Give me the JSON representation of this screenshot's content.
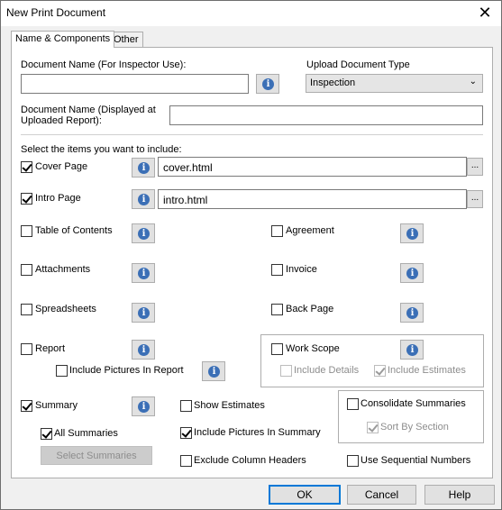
{
  "window": {
    "title": "New Print Document",
    "close_glyph": "✕"
  },
  "tabs": [
    {
      "label": "Name & Components",
      "active": true
    },
    {
      "label": "Other",
      "active": false
    }
  ],
  "form": {
    "doc_name_label": "Document Name (For Inspector Use):",
    "doc_name_value": "",
    "upload_type_label": "Upload Document Type",
    "upload_type_value": "Inspection",
    "doc_display_label_line1": "Document Name (Displayed at",
    "doc_display_label_line2": "Uploaded Report):",
    "doc_display_value": "",
    "select_items_label": "Select the items you want to include:"
  },
  "items": {
    "cover_page": {
      "label": "Cover Page",
      "checked": true,
      "file": "cover.html"
    },
    "intro_page": {
      "label": "Intro Page",
      "checked": true,
      "file": "intro.html"
    },
    "table_of_contents": {
      "label": "Table of Contents",
      "checked": false
    },
    "agreement": {
      "label": "Agreement",
      "checked": false
    },
    "attachments": {
      "label": "Attachments",
      "checked": false
    },
    "invoice": {
      "label": "Invoice",
      "checked": false
    },
    "spreadsheets": {
      "label": "Spreadsheets",
      "checked": false
    },
    "back_page": {
      "label": "Back Page",
      "checked": false
    },
    "report": {
      "label": "Report",
      "checked": false
    },
    "include_pictures_in_report": {
      "label": "Include Pictures In Report",
      "checked": false
    },
    "work_scope": {
      "label": "Work Scope",
      "checked": false
    },
    "include_details": {
      "label": "Include Details",
      "checked": false,
      "disabled": true
    },
    "include_estimates": {
      "label": "Include Estimates",
      "checked": true,
      "disabled": true
    },
    "summary": {
      "label": "Summary",
      "checked": true
    },
    "show_estimates": {
      "label": "Show Estimates",
      "checked": false
    },
    "consolidate_summaries": {
      "label": "Consolidate Summaries",
      "checked": false
    },
    "sort_by_section": {
      "label": "Sort By Section",
      "checked": true,
      "disabled": true
    },
    "all_summaries": {
      "label": "All Summaries",
      "checked": true
    },
    "include_pictures_in_summary": {
      "label": "Include Pictures In Summary",
      "checked": true
    },
    "select_summaries_button": "Select Summaries",
    "exclude_column_headers": {
      "label": "Exclude Column Headers",
      "checked": false
    },
    "use_sequential_numbers": {
      "label": "Use Sequential Numbers",
      "checked": false
    }
  },
  "icons": {
    "info": "i",
    "ellipsis": "..."
  },
  "buttons": {
    "ok": "OK",
    "cancel": "Cancel",
    "help": "Help"
  },
  "colors": {
    "info_blue": "#3b6fb6",
    "default_button_border": "#0078d7"
  }
}
